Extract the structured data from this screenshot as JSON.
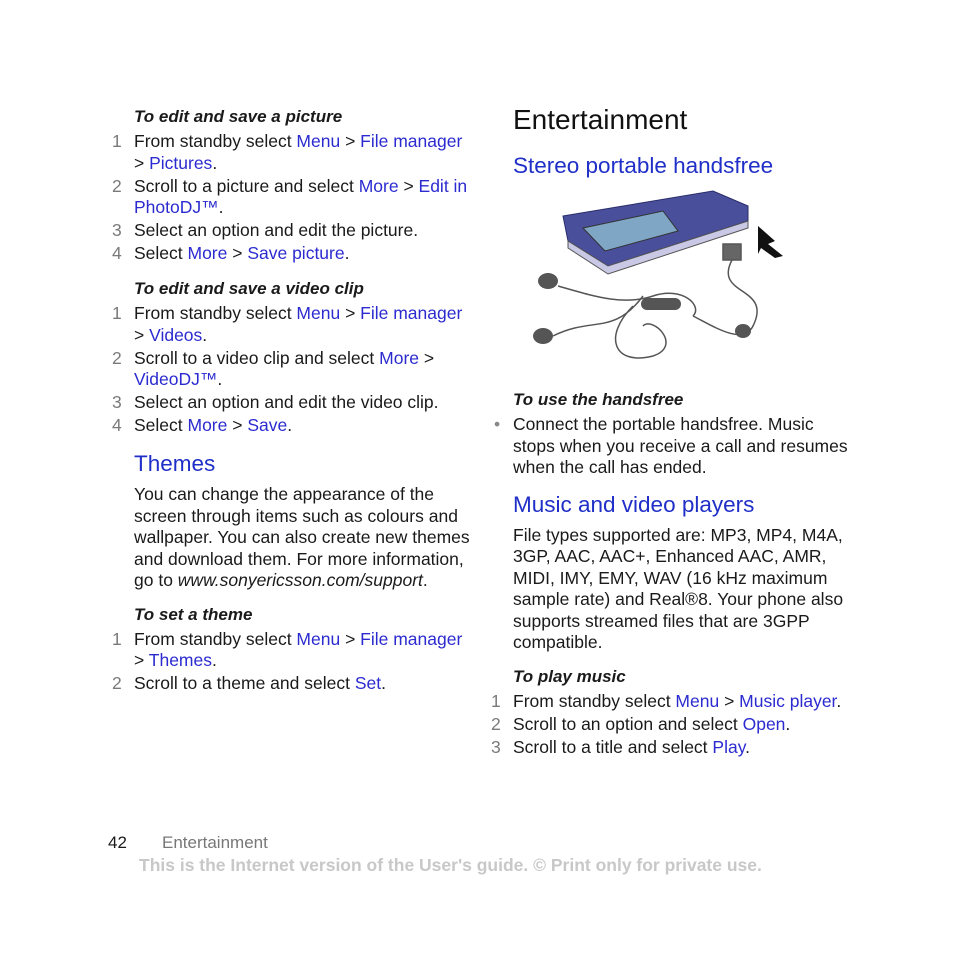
{
  "left": {
    "picture": {
      "title": "To edit and save a picture",
      "steps": [
        {
          "n": "1",
          "parts": [
            [
              "From standby select ",
              0
            ],
            [
              "Menu",
              1
            ],
            [
              " > ",
              0
            ],
            [
              "File manager",
              1
            ],
            [
              " > ",
              0
            ],
            [
              "Pictures",
              1
            ],
            [
              ".",
              0
            ]
          ]
        },
        {
          "n": "2",
          "parts": [
            [
              "Scroll to a picture and select ",
              0
            ],
            [
              "More",
              1
            ],
            [
              " > ",
              0
            ],
            [
              "Edit in PhotoDJ™",
              1
            ],
            [
              ".",
              0
            ]
          ]
        },
        {
          "n": "3",
          "parts": [
            [
              "Select an option and edit the picture.",
              0
            ]
          ]
        },
        {
          "n": "4",
          "parts": [
            [
              "Select ",
              0
            ],
            [
              "More",
              1
            ],
            [
              " > ",
              0
            ],
            [
              "Save picture",
              1
            ],
            [
              ".",
              0
            ]
          ]
        }
      ]
    },
    "video": {
      "title": "To edit and save a video clip",
      "steps": [
        {
          "n": "1",
          "parts": [
            [
              "From standby select ",
              0
            ],
            [
              "Menu",
              1
            ],
            [
              " > ",
              0
            ],
            [
              "File manager",
              1
            ],
            [
              " > ",
              0
            ],
            [
              "Videos",
              1
            ],
            [
              ".",
              0
            ]
          ]
        },
        {
          "n": "2",
          "parts": [
            [
              "Scroll to a video clip and select ",
              0
            ],
            [
              "More",
              1
            ],
            [
              " > ",
              0
            ],
            [
              "VideoDJ™",
              1
            ],
            [
              ".",
              0
            ]
          ]
        },
        {
          "n": "3",
          "parts": [
            [
              "Select an option and edit the video clip.",
              0
            ]
          ]
        },
        {
          "n": "4",
          "parts": [
            [
              "Select ",
              0
            ],
            [
              "More",
              1
            ],
            [
              " > ",
              0
            ],
            [
              "Save",
              1
            ],
            [
              ".",
              0
            ]
          ]
        }
      ]
    },
    "themes": {
      "heading": "Themes",
      "body": "You can change the appearance of the screen through items such as colours and wallpaper. You can also create new themes and download them. For more information, go to ",
      "url": "www.sonyericsson.com/support",
      "url_end": ".",
      "proc_title": "To set a theme",
      "steps": [
        {
          "n": "1",
          "parts": [
            [
              "From standby select ",
              0
            ],
            [
              "Menu",
              1
            ],
            [
              " > ",
              0
            ],
            [
              "File manager",
              1
            ],
            [
              " > ",
              0
            ],
            [
              "Themes",
              1
            ],
            [
              ".",
              0
            ]
          ]
        },
        {
          "n": "2",
          "parts": [
            [
              "Scroll to a theme and select ",
              0
            ],
            [
              "Set",
              1
            ],
            [
              ".",
              0
            ]
          ]
        }
      ]
    }
  },
  "right": {
    "title": "Entertainment",
    "handsfree": {
      "heading": "Stereo portable handsfree",
      "proc_title": "To use the handsfree",
      "bullet": "Connect the portable handsfree. Music stops when you receive a call and resumes when the call has ended."
    },
    "music": {
      "heading": "Music and video players",
      "body": "File types supported are: MP3, MP4, M4A, 3GP, AAC, AAC+, Enhanced AAC, AMR, MIDI, IMY, EMY, WAV (16 kHz maximum sample rate) and Real®8. Your phone also supports streamed files that are 3GPP compatible.",
      "proc_title": "To play music",
      "steps": [
        {
          "n": "1",
          "parts": [
            [
              "From standby select ",
              0
            ],
            [
              "Menu",
              1
            ],
            [
              " > ",
              0
            ],
            [
              "Music player",
              1
            ],
            [
              ".",
              0
            ]
          ]
        },
        {
          "n": "2",
          "parts": [
            [
              "Scroll to an option and select ",
              0
            ],
            [
              "Open",
              1
            ],
            [
              ".",
              0
            ]
          ]
        },
        {
          "n": "3",
          "parts": [
            [
              "Scroll to a title and select ",
              0
            ],
            [
              "Play",
              1
            ],
            [
              ".",
              0
            ]
          ]
        }
      ]
    }
  },
  "footer": {
    "page_number": "42",
    "section": "Entertainment",
    "note": "This is the Internet version of the User's guide. © Print only for private use."
  }
}
